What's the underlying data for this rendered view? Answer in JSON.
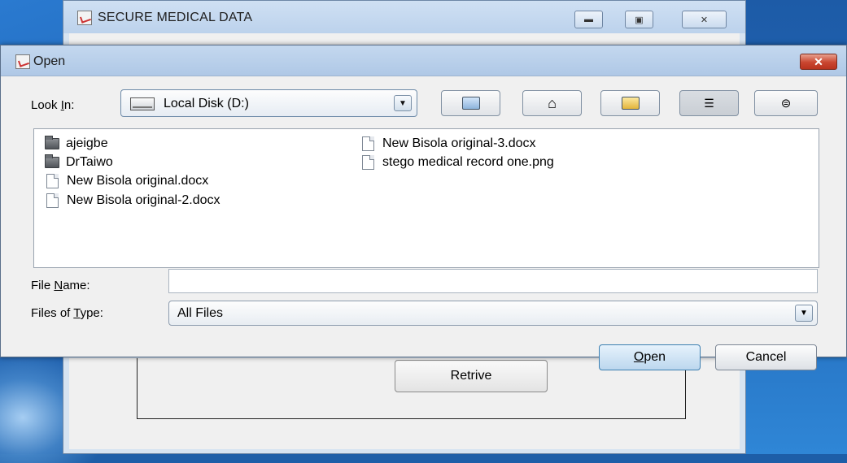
{
  "app": {
    "title": "SECURE MEDICAL DATA",
    "retrieve_label": "Retrive"
  },
  "dialog": {
    "title": "Open",
    "close_label": "✕",
    "look_in": {
      "label_before": "Look ",
      "label_underlined": "I",
      "label_after": "n:",
      "value": "Local Disk (D:)"
    },
    "toolbar": [
      {
        "name": "up-one-level",
        "icon": "folder-up-icon"
      },
      {
        "name": "home",
        "icon": "home-icon"
      },
      {
        "name": "create-new-folder",
        "icon": "new-folder-icon"
      },
      {
        "name": "list-view",
        "icon": "list-view-icon"
      },
      {
        "name": "details-view",
        "icon": "details-view-icon"
      }
    ],
    "files": [
      {
        "name": "ajeigbe",
        "type": "folder"
      },
      {
        "name": "DrTaiwo",
        "type": "folder"
      },
      {
        "name": "New Bisola original.docx",
        "type": "file"
      },
      {
        "name": "New Bisola original-2.docx",
        "type": "file"
      },
      {
        "name": "New Bisola original-3.docx",
        "type": "file"
      },
      {
        "name": "stego medical record one.png",
        "type": "file"
      }
    ],
    "file_name": {
      "label_before": "File ",
      "label_underlined": "N",
      "label_after": "ame:",
      "value": ""
    },
    "file_type": {
      "label_before": "Files of ",
      "label_underlined": "T",
      "label_after": "ype:",
      "value": "All Files"
    },
    "open_button": {
      "underlined": "O",
      "rest": "pen"
    },
    "cancel_label": "Cancel"
  }
}
